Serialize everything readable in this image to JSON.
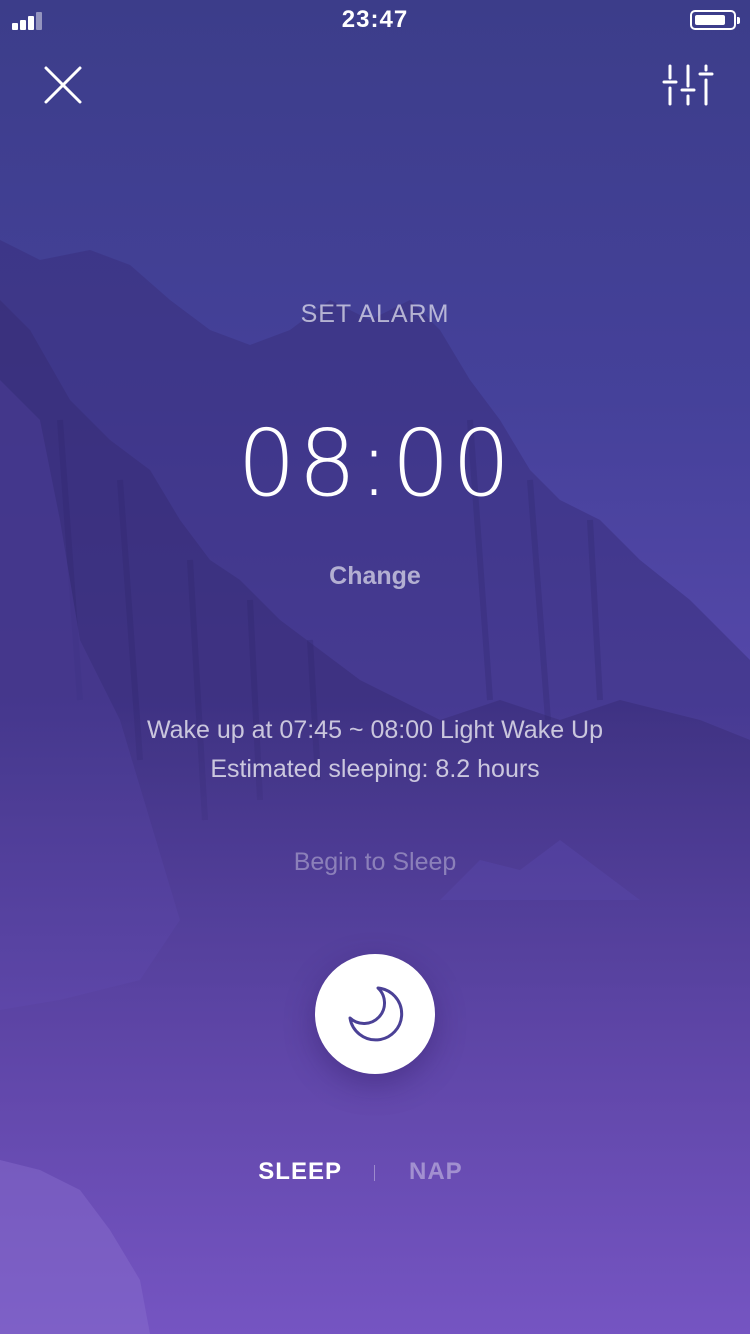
{
  "status_bar": {
    "time": "23:47"
  },
  "header": {
    "close_icon": "close-icon",
    "settings_icon": "sliders-icon"
  },
  "alarm": {
    "heading": "SET ALARM",
    "time": "08:00",
    "change_label": "Change"
  },
  "info": {
    "wake_line": "Wake up at 07:45 ~ 08:00 Light Wake Up",
    "estimate_line": "Estimated sleeping: 8.2 hours"
  },
  "action": {
    "begin_label": "Begin to Sleep",
    "button_icon": "moon-icon"
  },
  "modes": {
    "items": [
      {
        "label": "SLEEP",
        "active": true
      },
      {
        "label": "NAP",
        "active": false
      }
    ]
  },
  "colors": {
    "background_top": "#3c3d8a",
    "background_bottom": "#7d55cc",
    "icon_accent": "#4b4196"
  }
}
